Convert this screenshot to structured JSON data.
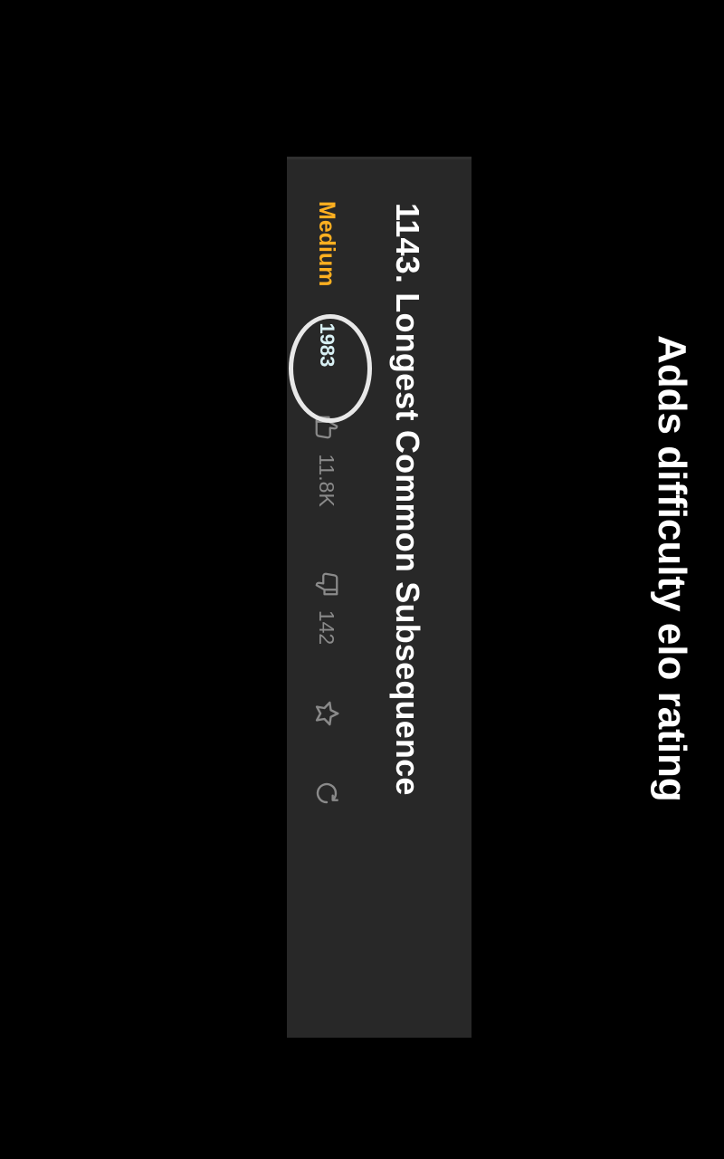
{
  "problem": {
    "title": "1143. Longest Common Subsequence",
    "difficulty": "Medium",
    "elo_rating": "1983",
    "likes": "11.8K",
    "dislikes": "142"
  },
  "icons": {
    "like": "thumbs-up-icon",
    "dislike": "thumbs-down-icon",
    "favorite": "star-icon",
    "reset": "refresh-icon"
  },
  "colors": {
    "background": "#000000",
    "panel": "#282828",
    "difficulty_medium": "#ffb020",
    "elo_text": "#d8f0f4",
    "muted": "#8a8a8a",
    "highlight_circle": "#e8e8e8"
  },
  "annotation": {
    "caption": "Adds difficulty elo rating"
  }
}
